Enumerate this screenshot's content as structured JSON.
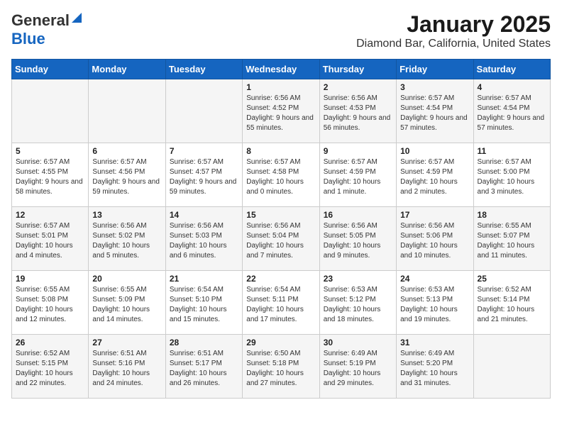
{
  "logo": {
    "general": "General",
    "blue": "Blue"
  },
  "header": {
    "title": "January 2025",
    "subtitle": "Diamond Bar, California, United States"
  },
  "weekdays": [
    "Sunday",
    "Monday",
    "Tuesday",
    "Wednesday",
    "Thursday",
    "Friday",
    "Saturday"
  ],
  "weeks": [
    [
      {
        "day": "",
        "info": ""
      },
      {
        "day": "",
        "info": ""
      },
      {
        "day": "",
        "info": ""
      },
      {
        "day": "1",
        "info": "Sunrise: 6:56 AM\nSunset: 4:52 PM\nDaylight: 9 hours and 55 minutes."
      },
      {
        "day": "2",
        "info": "Sunrise: 6:56 AM\nSunset: 4:53 PM\nDaylight: 9 hours and 56 minutes."
      },
      {
        "day": "3",
        "info": "Sunrise: 6:57 AM\nSunset: 4:54 PM\nDaylight: 9 hours and 57 minutes."
      },
      {
        "day": "4",
        "info": "Sunrise: 6:57 AM\nSunset: 4:54 PM\nDaylight: 9 hours and 57 minutes."
      }
    ],
    [
      {
        "day": "5",
        "info": "Sunrise: 6:57 AM\nSunset: 4:55 PM\nDaylight: 9 hours and 58 minutes."
      },
      {
        "day": "6",
        "info": "Sunrise: 6:57 AM\nSunset: 4:56 PM\nDaylight: 9 hours and 59 minutes."
      },
      {
        "day": "7",
        "info": "Sunrise: 6:57 AM\nSunset: 4:57 PM\nDaylight: 9 hours and 59 minutes."
      },
      {
        "day": "8",
        "info": "Sunrise: 6:57 AM\nSunset: 4:58 PM\nDaylight: 10 hours and 0 minutes."
      },
      {
        "day": "9",
        "info": "Sunrise: 6:57 AM\nSunset: 4:59 PM\nDaylight: 10 hours and 1 minute."
      },
      {
        "day": "10",
        "info": "Sunrise: 6:57 AM\nSunset: 4:59 PM\nDaylight: 10 hours and 2 minutes."
      },
      {
        "day": "11",
        "info": "Sunrise: 6:57 AM\nSunset: 5:00 PM\nDaylight: 10 hours and 3 minutes."
      }
    ],
    [
      {
        "day": "12",
        "info": "Sunrise: 6:57 AM\nSunset: 5:01 PM\nDaylight: 10 hours and 4 minutes."
      },
      {
        "day": "13",
        "info": "Sunrise: 6:56 AM\nSunset: 5:02 PM\nDaylight: 10 hours and 5 minutes."
      },
      {
        "day": "14",
        "info": "Sunrise: 6:56 AM\nSunset: 5:03 PM\nDaylight: 10 hours and 6 minutes."
      },
      {
        "day": "15",
        "info": "Sunrise: 6:56 AM\nSunset: 5:04 PM\nDaylight: 10 hours and 7 minutes."
      },
      {
        "day": "16",
        "info": "Sunrise: 6:56 AM\nSunset: 5:05 PM\nDaylight: 10 hours and 9 minutes."
      },
      {
        "day": "17",
        "info": "Sunrise: 6:56 AM\nSunset: 5:06 PM\nDaylight: 10 hours and 10 minutes."
      },
      {
        "day": "18",
        "info": "Sunrise: 6:55 AM\nSunset: 5:07 PM\nDaylight: 10 hours and 11 minutes."
      }
    ],
    [
      {
        "day": "19",
        "info": "Sunrise: 6:55 AM\nSunset: 5:08 PM\nDaylight: 10 hours and 12 minutes."
      },
      {
        "day": "20",
        "info": "Sunrise: 6:55 AM\nSunset: 5:09 PM\nDaylight: 10 hours and 14 minutes."
      },
      {
        "day": "21",
        "info": "Sunrise: 6:54 AM\nSunset: 5:10 PM\nDaylight: 10 hours and 15 minutes."
      },
      {
        "day": "22",
        "info": "Sunrise: 6:54 AM\nSunset: 5:11 PM\nDaylight: 10 hours and 17 minutes."
      },
      {
        "day": "23",
        "info": "Sunrise: 6:53 AM\nSunset: 5:12 PM\nDaylight: 10 hours and 18 minutes."
      },
      {
        "day": "24",
        "info": "Sunrise: 6:53 AM\nSunset: 5:13 PM\nDaylight: 10 hours and 19 minutes."
      },
      {
        "day": "25",
        "info": "Sunrise: 6:52 AM\nSunset: 5:14 PM\nDaylight: 10 hours and 21 minutes."
      }
    ],
    [
      {
        "day": "26",
        "info": "Sunrise: 6:52 AM\nSunset: 5:15 PM\nDaylight: 10 hours and 22 minutes."
      },
      {
        "day": "27",
        "info": "Sunrise: 6:51 AM\nSunset: 5:16 PM\nDaylight: 10 hours and 24 minutes."
      },
      {
        "day": "28",
        "info": "Sunrise: 6:51 AM\nSunset: 5:17 PM\nDaylight: 10 hours and 26 minutes."
      },
      {
        "day": "29",
        "info": "Sunrise: 6:50 AM\nSunset: 5:18 PM\nDaylight: 10 hours and 27 minutes."
      },
      {
        "day": "30",
        "info": "Sunrise: 6:49 AM\nSunset: 5:19 PM\nDaylight: 10 hours and 29 minutes."
      },
      {
        "day": "31",
        "info": "Sunrise: 6:49 AM\nSunset: 5:20 PM\nDaylight: 10 hours and 31 minutes."
      },
      {
        "day": "",
        "info": ""
      }
    ]
  ]
}
